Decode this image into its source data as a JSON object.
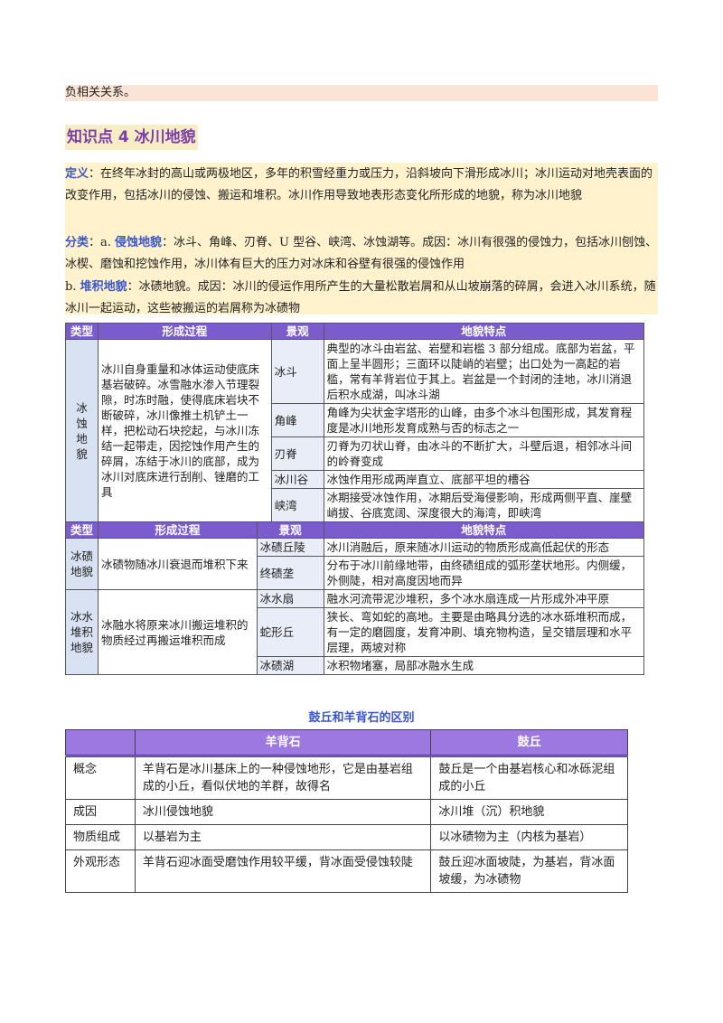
{
  "top_text": "负相关关系。",
  "heading": "知识点 4  冰川地貌",
  "definition": {
    "label": "定义",
    "text": "：在终年冰封的高山或两极地区，多年的积雪经重力或压力，沿斜坡向下滑形成冰川；冰川运动对地壳表面的改变作用，包括冰川的侵蚀、搬运和堆积。冰川作用导致地表形态变化所形成的地貌，称为冰川地貌"
  },
  "classification": {
    "label": "分类",
    "a_prefix": "：a. ",
    "a_label": "侵蚀地貌",
    "a_text": "：冰斗、角峰、刃脊、U 型谷、峡湾、冰蚀湖等。成因：冰川有很强的侵蚀力，包括冰川刨蚀、冰楔、磨蚀和挖蚀作用，冰川体有巨大的压力对冰床和谷壁有很强的侵蚀作用",
    "b_prefix": "b. ",
    "b_label": "堆积地貌",
    "b_text": "：冰碛地貌。成因：冰川的侵运作用所产生的大量松散岩屑和从山坡崩落的碎屑，会进入冰川系统，随冰川一起运动，这些被搬运的岩屑称为冰碛物"
  },
  "table1": {
    "headers": [
      "类型",
      "形成过程",
      "景观",
      "地貌特点"
    ],
    "category": "冰蚀地貌",
    "process": "冰川自身重量和冰体运动使底床基岩破碎。冰雪融水渗入节理裂隙，时冻时融，使得底床岩块不断破碎，冰川像推土机铲土一样，把松动石块挖起，与冰川冻结一起带走，因挖蚀作用产生的碎屑，冻结于冰川的底部，成为冰川对底床进行刮削、锉磨的工具",
    "rows": [
      {
        "landform": "冰斗",
        "feature": "典型的冰斗由岩盆、岩壁和岩槛 3 部分组成。底部为岩盆，平面上呈半圆形；三面环以陡峭的岩壁；出口处为一高起的岩槛，常有羊背岩位于其上。岩盆是一个封闭的洼地，冰川消退后积水成湖，叫冰斗湖"
      },
      {
        "landform": "角峰",
        "feature": "角峰为尖状金字塔形的山峰，由多个冰斗包围形成，其发育程度是冰川地形发育成熟与否的标志之一"
      },
      {
        "landform": "刃脊",
        "feature": "刃脊为刃状山脊，由冰斗的不断扩大，斗壁后退，相邻冰斗间的岭脊变成"
      },
      {
        "landform": "冰川谷",
        "feature": "冰蚀作用形成两岸直立、底部平坦的槽谷"
      },
      {
        "landform": "峡湾",
        "feature": "冰期接受冰蚀作用，冰期后受海侵影响，形成两侧平直、崖壁峭拔、谷底宽阔、深度很大的海湾，即峡湾"
      }
    ]
  },
  "table2": {
    "headers": [
      "类型",
      "形成过程",
      "景观",
      "地貌特点"
    ],
    "groups": [
      {
        "category": "冰碛地貌",
        "process": "冰碛物随冰川衰退而堆积下来",
        "rows": [
          {
            "landform": "冰碛丘陵",
            "feature": "冰川消融后，原来随冰川运动的物质形成高低起伏的形态"
          },
          {
            "landform": "终碛垄",
            "feature": "分布于冰川前缘地带，由终碛组成的弧形垄状地形。内侧缓，外侧陡，相对高度因地而异"
          }
        ]
      },
      {
        "category": "冰水堆积地貌",
        "process": "冰融水将原来冰川搬运堆积的物质经过再搬运堆积而成",
        "rows": [
          {
            "landform": "冰水扇",
            "feature": "融水河流带泥沙堆积，多个冰水扇连成一片形成外冲平原"
          },
          {
            "landform": "蛇形丘",
            "feature": "狭长、弯如蛇的高地。主要是由略具分选的冰水砾堆积而成，有一定的磨圆度，发育冲刷、填充物构造，呈交错层理和水平层理，两坡对称"
          },
          {
            "landform": "冰碛湖",
            "feature": "冰积物堵塞，局部冰融水生成"
          }
        ]
      }
    ]
  },
  "table3": {
    "title": "鼓丘和羊背石的区别",
    "headers": [
      "",
      "羊背石",
      "鼓丘"
    ],
    "rows": [
      {
        "item": "概念",
        "a": "羊背石是冰川基床上的一种侵蚀地形，它是由基岩组成的小丘，看似伏地的羊群，故得名",
        "b": "鼓丘是一个由基岩核心和冰砾泥组成的小丘"
      },
      {
        "item": "成因",
        "a": "冰川侵蚀地貌",
        "b": "冰川堆（沉）积地貌"
      },
      {
        "item": "物质组成",
        "a": "以基岩为主",
        "b": "以冰碛物为主（内核为基岩）"
      },
      {
        "item": "外观形态",
        "a": "羊背石迎冰面受磨蚀作用较平缓，背冰面受侵蚀较陡",
        "b": "鼓丘迎冰面坡陡，为基岩，背冰面坡缓，为冰碛物"
      }
    ]
  }
}
